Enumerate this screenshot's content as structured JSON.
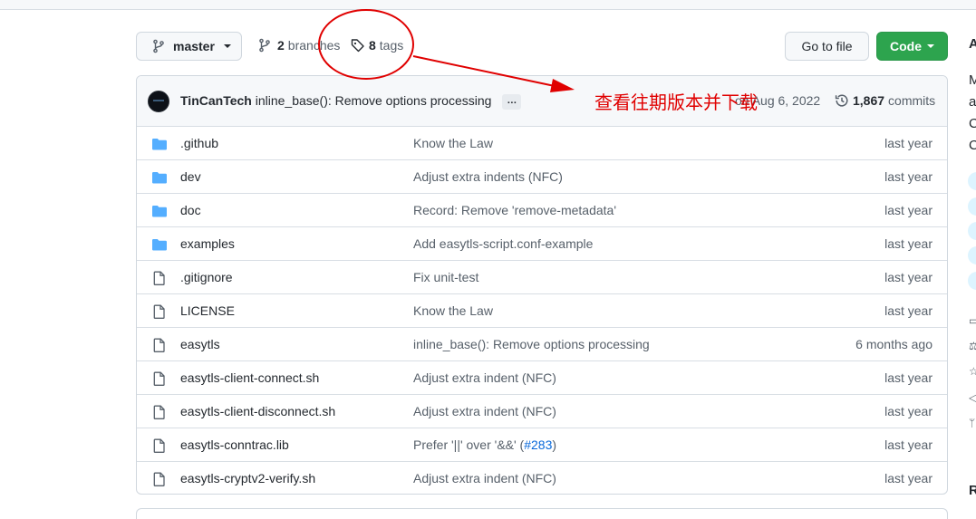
{
  "repo_bar": {
    "branch": "master",
    "branches_count": "2",
    "branches_label": "branches",
    "tags_count": "8",
    "tags_label": "tags",
    "go_to_file": "Go to file",
    "code": "Code"
  },
  "latest_commit": {
    "author": "TinCanTech",
    "message": "inline_base(): Remove options processing",
    "ellipsis": "…",
    "date": "on Aug 6, 2022",
    "commits_count": "1,867",
    "commits_label": "commits"
  },
  "files": [
    {
      "type": "folder",
      "name": ".github",
      "message": "Know the Law",
      "age": "last year"
    },
    {
      "type": "folder",
      "name": "dev",
      "message": "Adjust extra indents (NFC)",
      "age": "last year"
    },
    {
      "type": "folder",
      "name": "doc",
      "message": "Record: Remove 'remove-metadata'",
      "age": "last year"
    },
    {
      "type": "folder",
      "name": "examples",
      "message": "Add easytls-script.conf-example",
      "age": "last year"
    },
    {
      "type": "file",
      "name": ".gitignore",
      "message": "Fix unit-test",
      "age": "last year"
    },
    {
      "type": "file",
      "name": "LICENSE",
      "message": "Know the Law",
      "age": "last year"
    },
    {
      "type": "file",
      "name": "easytls",
      "message": "inline_base(): Remove options processing",
      "age": "6 months ago"
    },
    {
      "type": "file",
      "name": "easytls-client-connect.sh",
      "message": "Adjust extra indent (NFC)",
      "age": "last year"
    },
    {
      "type": "file",
      "name": "easytls-client-disconnect.sh",
      "message": "Adjust extra indent (NFC)",
      "age": "last year"
    },
    {
      "type": "file",
      "name": "easytls-conntrac.lib",
      "message": "Prefer '||' over '&&' (",
      "message_link": "#283",
      "message_tail": ")",
      "age": "last year"
    },
    {
      "type": "file",
      "name": "easytls-cryptv2-verify.sh",
      "message": "Adjust extra indent (NFC)",
      "age": "last year"
    }
  ],
  "sidebar_partial": {
    "heading": "A",
    "lines": [
      "M",
      "a",
      "C",
      "C"
    ],
    "bottom_heading": "R"
  },
  "annotation": {
    "text": "查看往期版本并下载",
    "color": "#e00000"
  },
  "colors": {
    "accent_green": "#2da44e",
    "link_blue": "#0969da",
    "folder_blue": "#54aeff"
  },
  "icons": {
    "branch": "git-branch-icon",
    "tag": "tag-icon",
    "history": "history-icon",
    "folder": "folder-icon",
    "file": "file-icon"
  }
}
